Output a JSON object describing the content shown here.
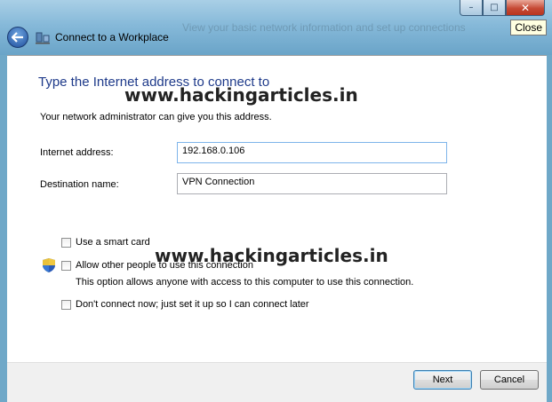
{
  "window": {
    "title": "Connect to a Workplace",
    "tooltip": "Close",
    "background_hint": "View your basic network information and set up connections"
  },
  "controls": {
    "minimize": "–",
    "maximize": "□",
    "close": "✕"
  },
  "icons": {
    "back": "back-arrow-icon",
    "app": "network-icon",
    "shield": "uac-shield-icon"
  },
  "main": {
    "heading": "Type the Internet address to connect to",
    "info": "Your network administrator can give you this address.",
    "internet_address_label": "Internet address:",
    "internet_address_value": "192.168.0.106",
    "destination_label": "Destination name:",
    "destination_value": "VPN Connection",
    "smart_card": "Use a smart card",
    "allow_others": "Allow other people to use this connection",
    "allow_others_desc": "This option allows anyone with access to this computer to use this connection.",
    "dont_connect": "Don't connect now; just set it up so I can connect later"
  },
  "watermark": "www.hackingarticles.in",
  "footer": {
    "next": "Next",
    "cancel": "Cancel"
  },
  "colors": {
    "heading": "#1e3a8a",
    "titlebar": "#86b9d9"
  }
}
